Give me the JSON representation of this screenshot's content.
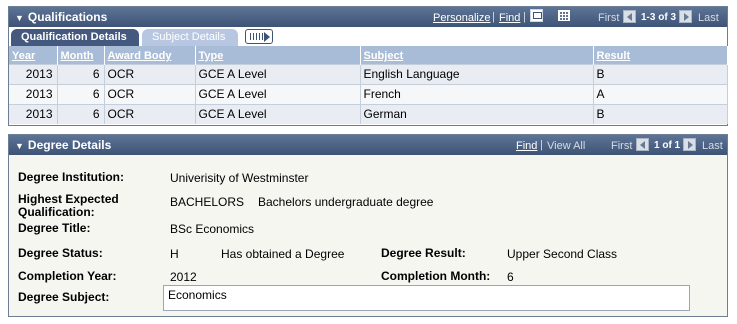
{
  "qualifications": {
    "title": "Qualifications",
    "personalize": "Personalize",
    "find": "Find",
    "sep1": "|",
    "sep2": "|",
    "first": "First",
    "count": "1-3 of 3",
    "last": "Last",
    "tabs": [
      "Qualification Details",
      "Subject Details"
    ],
    "columns": [
      "Year",
      "Month",
      "Award Body",
      "Type",
      "Subject",
      "Result"
    ],
    "rows": [
      {
        "year": "2013",
        "month": "6",
        "award_body": "OCR",
        "type": "GCE A Level",
        "subject": "English Language",
        "result": "B"
      },
      {
        "year": "2013",
        "month": "6",
        "award_body": "OCR",
        "type": "GCE A Level",
        "subject": "French",
        "result": "A"
      },
      {
        "year": "2013",
        "month": "6",
        "award_body": "OCR",
        "type": "GCE A Level",
        "subject": "German",
        "result": "B"
      }
    ]
  },
  "degree": {
    "title": "Degree Details",
    "find": "Find",
    "view_all": "View All",
    "sep": "|",
    "first": "First",
    "count": "1 of 1",
    "last": "Last",
    "fields": {
      "institution_label": "Degree Institution:",
      "institution_value": "Univerisity of Westminster",
      "highest_label": "Highest Expected Qualification:",
      "highest_code": "BACHELORS",
      "highest_desc": "Bachelors undergraduate degree",
      "title_label": "Degree Title:",
      "title_value": "BSc Economics",
      "status_label": "Degree Status:",
      "status_code": "H",
      "status_desc": "Has obtained a Degree",
      "result_label": "Degree Result:",
      "result_value": "Upper Second Class",
      "comp_year_label": "Completion Year:",
      "comp_year_value": "2012",
      "comp_month_label": "Completion Month:",
      "comp_month_value": "6",
      "subject_label": "Degree Subject:",
      "subject_value": "Economics"
    }
  },
  "colors": {
    "header_bg": "#3d5477",
    "active_tab": "#44597d",
    "inactive_tab": "#b8c7e1",
    "grid_header": "#a8bcd7"
  }
}
